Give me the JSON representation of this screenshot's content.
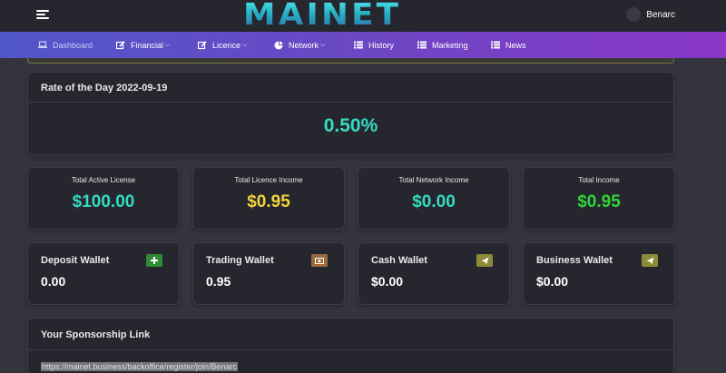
{
  "header": {
    "logo_text": "MAINET",
    "user_name": "Benarc"
  },
  "nav": {
    "items": [
      {
        "label": "Dashboard",
        "icon": "laptop-icon",
        "dropdown": false
      },
      {
        "label": "Financial",
        "icon": "edit-icon",
        "dropdown": true
      },
      {
        "label": "Licence",
        "icon": "edit-icon",
        "dropdown": true
      },
      {
        "label": "Network",
        "icon": "pie-chart-icon",
        "dropdown": true
      },
      {
        "label": "History",
        "icon": "list-icon",
        "dropdown": false
      },
      {
        "label": "Marketing",
        "icon": "list-icon",
        "dropdown": false
      },
      {
        "label": "News",
        "icon": "list-icon",
        "dropdown": false
      }
    ]
  },
  "rate": {
    "title": "Rate of the Day 2022-09-19",
    "value": "0.50%"
  },
  "stats": [
    {
      "label": "Total Active License",
      "value": "$100.00",
      "color": "#35dbc0"
    },
    {
      "label": "Total Licence Income",
      "value": "$0.95",
      "color": "#f2d43a"
    },
    {
      "label": "Total Network Income",
      "value": "$0.00",
      "color": "#35dbc0"
    },
    {
      "label": "Total Income",
      "value": "$0.95",
      "color": "#30d53a"
    }
  ],
  "wallets": [
    {
      "title": "Deposit Wallet",
      "value": "0.00",
      "icon": "plus-icon",
      "button_color": "#2f8a36"
    },
    {
      "title": "Trading Wallet",
      "value": "0.95",
      "icon": "money-icon",
      "button_color": "#9a6a3c"
    },
    {
      "title": "Cash Wallet",
      "value": "$0.00",
      "icon": "send-icon",
      "button_color": "#8d8a3a"
    },
    {
      "title": "Business Wallet",
      "value": "$0.00",
      "icon": "send-icon",
      "button_color": "#8d8a3a"
    }
  ],
  "sponsor": {
    "title": "Your Sponsorship Link",
    "link": "https://mainet.business/backoffice/register/join/Benarc"
  }
}
